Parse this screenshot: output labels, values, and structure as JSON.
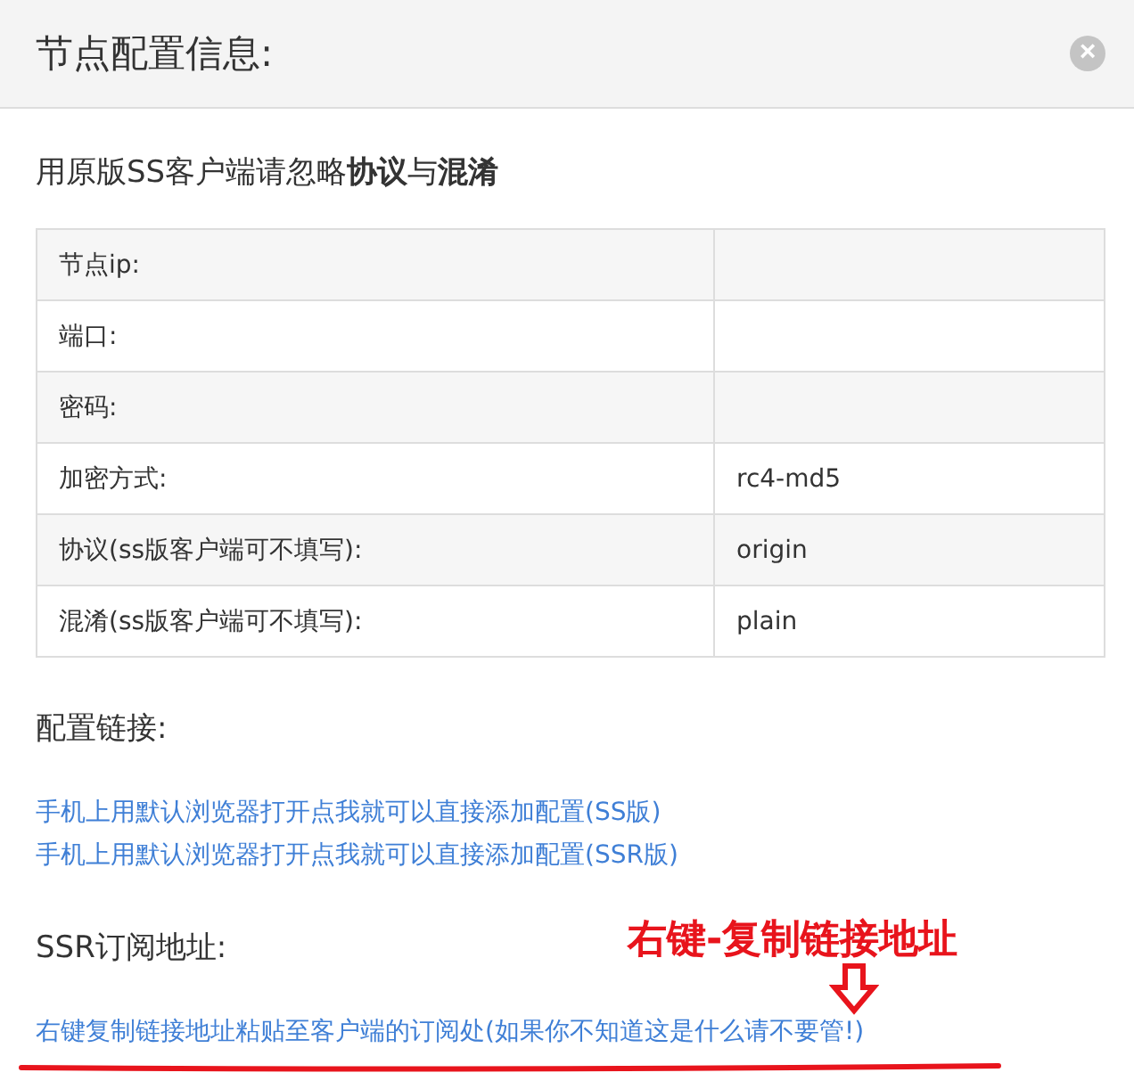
{
  "dialog": {
    "title": "节点配置信息:",
    "close": "×"
  },
  "notice": "用原版SS客户端请忽略**协议**与**混淆**",
  "table": {
    "rows": [
      {
        "label": "节点ip:"
      },
      {
        "label": "端口:"
      },
      {
        "label": "密码:"
      },
      {
        "label": "加密方式:",
        "value": "rc4-md5"
      },
      {
        "label": "协议(ss版客户端可不填写):",
        "value": "origin"
      },
      {
        "label": "混淆(ss版客户端可不填写):",
        "value": "plain"
      }
    ]
  },
  "config_links": {
    "heading": "配置链接:",
    "links": [
      "手机上用默认浏览器打开点我就可以直接添加配置(SS版)",
      "手机上用默认浏览器打开点我就可以直接添加配置(SSR版)"
    ]
  },
  "subscription": {
    "heading": "SSR订阅地址:",
    "link": "右键复制链接地址粘贴至客户端的订阅处(如果你不知道这是什么请不要管!)"
  },
  "annotation": {
    "text": "右键-复制链接地址"
  }
}
